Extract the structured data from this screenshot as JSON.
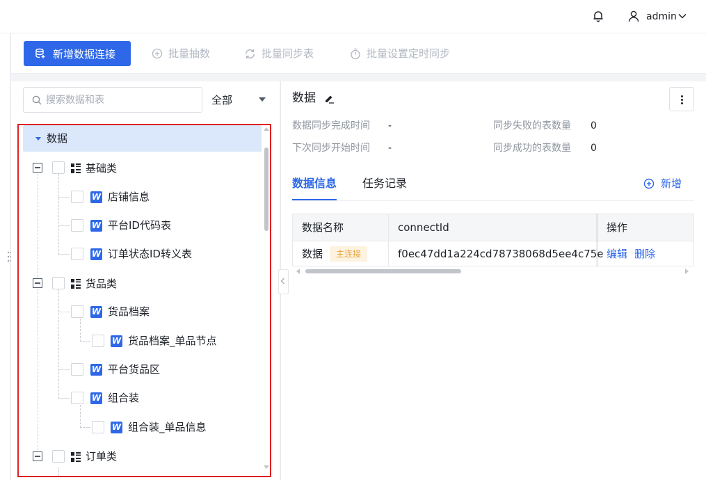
{
  "header": {
    "username": "admin"
  },
  "toolbar": {
    "new_connection": "新增数据连接",
    "batch_extract": "批量抽数",
    "batch_sync": "批量同步表",
    "batch_schedule": "批量设置定时同步"
  },
  "sidebar": {
    "search_placeholder": "搜索数据和表",
    "filter_value": "全部",
    "root_label": "数据",
    "groups": [
      {
        "label": "基础类",
        "items": [
          {
            "label": "店铺信息"
          },
          {
            "label": "平台ID代码表"
          },
          {
            "label": "订单状态ID转义表"
          }
        ]
      },
      {
        "label": "货品类",
        "items": [
          {
            "label": "货品档案",
            "children": [
              {
                "label": "货品档案_单品节点"
              }
            ]
          },
          {
            "label": "平台货品区"
          },
          {
            "label": "组合装",
            "children": [
              {
                "label": "组合装_单品信息"
              }
            ]
          }
        ]
      },
      {
        "label": "订单类",
        "items": []
      }
    ]
  },
  "detail": {
    "title": "数据",
    "sync_done_label": "数据同步完成时间",
    "sync_done_value": "-",
    "next_sync_label": "下次同步开始时间",
    "next_sync_value": "-",
    "failed_label": "同步失败的表数量",
    "failed_value": "0",
    "success_label": "同步成功的表数量",
    "success_value": "0",
    "tabs": [
      {
        "label": "数据信息",
        "active": true
      },
      {
        "label": "任务记录",
        "active": false
      }
    ],
    "add_label": "新增",
    "table": {
      "headers": [
        "数据名称",
        "connectId",
        "操作"
      ],
      "rows": [
        {
          "name": "数据",
          "status": "主连接",
          "connect_id": "f0ec47dd1a224cd78738068d5ee4c75e",
          "actions": [
            "编辑",
            "删除"
          ]
        }
      ]
    }
  },
  "colors": {
    "primary": "#2e68e8",
    "highlight_border": "#e02020",
    "badge_text": "#e8a33a",
    "badge_bg": "#fdf3e0"
  }
}
